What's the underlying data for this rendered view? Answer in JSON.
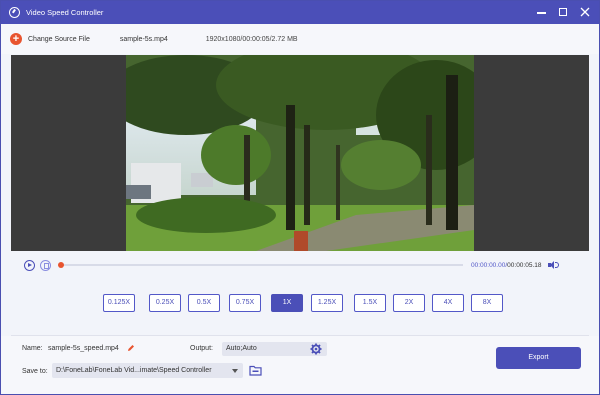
{
  "window": {
    "title": "Video Speed Controller"
  },
  "toolbar": {
    "change_source_label": "Change Source File",
    "filename": "sample-5s.mp4",
    "fileinfo": "1920x1080/00:00:05/2.72 MB"
  },
  "player": {
    "current_time": "00:00:00.00",
    "total_time": "00:00:05.18",
    "progress_fraction": 0.0
  },
  "speeds": {
    "options": [
      "0.125X",
      "0.25X",
      "0.5X",
      "0.75X",
      "1X",
      "1.25X",
      "1.5X",
      "2X",
      "4X",
      "8X"
    ],
    "selected": "1X"
  },
  "bottom": {
    "name_label": "Name:",
    "name_value": "sample-5s_speed.mp4",
    "output_label": "Output:",
    "output_value": "Auto;Auto",
    "save_label": "Save to:",
    "save_path": "D:\\FoneLab\\FoneLab Vid...imate\\Speed Controller",
    "export_label": "Export"
  },
  "colors": {
    "accent": "#4b4fb8",
    "highlight": "#e8542f"
  },
  "icons": {
    "app": "speedometer-icon",
    "add": "plus-circle-icon",
    "play": "play-icon",
    "stop": "stop-icon",
    "volume": "volume-icon",
    "edit": "pencil-icon",
    "settings": "gear-icon",
    "folder": "folder-icon"
  }
}
